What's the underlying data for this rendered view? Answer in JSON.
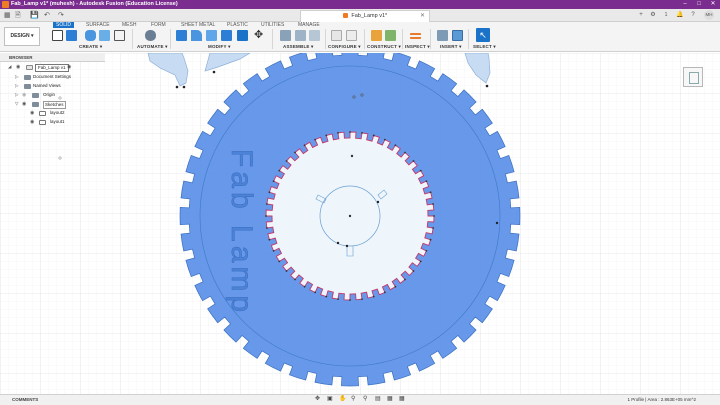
{
  "window": {
    "title": "Fab_Lamp v1* (muhesh) - Autodesk Fusion (Education License)",
    "controls": [
      "–",
      "□",
      "✕"
    ]
  },
  "document_tab": {
    "label": "Fab_Lamp v1*",
    "close": "✕"
  },
  "tabbar_right": {
    "count": "1",
    "user": "MH"
  },
  "workspace": {
    "label": "DESIGN ▾"
  },
  "ribbon": {
    "tabs": [
      "SOLID",
      "SURFACE",
      "MESH",
      "FORM",
      "SHEET METAL",
      "PLASTIC",
      "UTILITIES",
      "MANAGE"
    ],
    "active_tab": "SOLID",
    "groups": [
      "CREATE ▾",
      "AUTOMATE ▾",
      "MODIFY ▾",
      "ASSEMBLE ▾",
      "CONFIGURE ▾",
      "CONSTRUCT ▾",
      "INSPECT ▾",
      "INSERT ▾",
      "SELECT ▾"
    ]
  },
  "browser": {
    "title": "BROWSER",
    "items": [
      {
        "label": "Fab_Lamp v1",
        "level": 0
      },
      {
        "label": "Document Settings",
        "level": 1
      },
      {
        "label": "Named Views",
        "level": 1
      },
      {
        "label": "Origin",
        "level": 1
      },
      {
        "label": "Sketches",
        "level": 1
      },
      {
        "label": "layout2",
        "level": 2
      },
      {
        "label": "layout1",
        "level": 2
      }
    ]
  },
  "canvas": {
    "sketch_text": "Fab Lamp"
  },
  "comments": {
    "label": "COMMENTS"
  },
  "status": {
    "text": "1 Profile | Area : 2.863E+05 mm^2"
  },
  "colors": {
    "titlebar": "#7a2d8e",
    "profile_fill": "#5a8fe8",
    "inner_fill": "#eef5fb",
    "accent": "#1a73c8"
  }
}
